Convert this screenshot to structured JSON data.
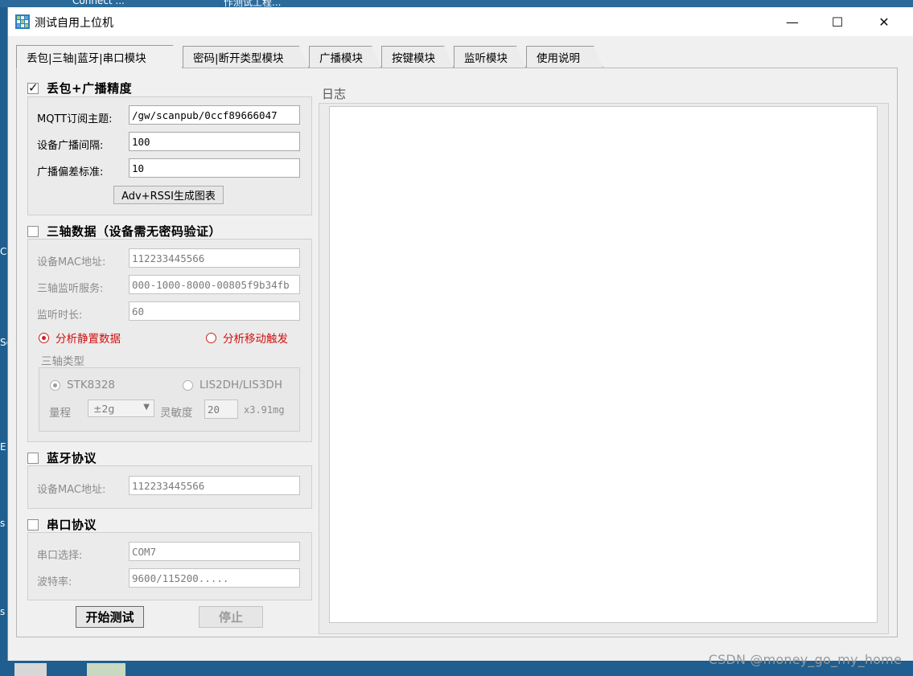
{
  "desktop": {
    "top_items": [
      "Connect ...",
      "作测试工程..."
    ],
    "left_letters": [
      "C",
      "Se",
      "E",
      "s",
      "s"
    ]
  },
  "window": {
    "title": "测试自用上位机",
    "minimize_glyph": "—",
    "maximize_glyph": "☐",
    "close_glyph": "✕"
  },
  "tabs": [
    {
      "label": "丢包|三轴|蓝牙|串口模块",
      "active": true
    },
    {
      "label": "密码|断开类型模块",
      "active": false
    },
    {
      "label": "广播模块",
      "active": false
    },
    {
      "label": "按键模块",
      "active": false
    },
    {
      "label": "监听模块",
      "active": false
    },
    {
      "label": "使用说明",
      "active": false
    }
  ],
  "loss": {
    "header": "丢包+广播精度",
    "checked": true,
    "mqtt_label": "MQTT订阅主题:",
    "mqtt_value": "/gw/scanpub/0ccf89666047",
    "interval_label": "设备广播间隔:",
    "interval_value": "100",
    "deviation_label": "广播偏差标准:",
    "deviation_value": "10",
    "chart_button": "Adv+RSSI生成图表"
  },
  "triaxial": {
    "header": "三轴数据（设备需无密码验证）",
    "checked": false,
    "mac_label": "设备MAC地址:",
    "mac_value": "112233445566",
    "service_label": "三轴监听服务:",
    "service_value": "000-1000-8000-00805f9b34fb",
    "duration_label": "监听时长:",
    "duration_value": "60",
    "radio_static": "分析静置数据",
    "radio_motion": "分析移动触发",
    "type_title": "三轴类型",
    "type_stk": "STK8328",
    "type_lis": "LIS2DH/LIS3DH",
    "range_label": "量程",
    "range_value": "±2g",
    "sensitivity_label": "灵敏度",
    "sensitivity_value": "20",
    "sensitivity_unit": "x3.91mg"
  },
  "bluetooth": {
    "header": "蓝牙协议",
    "checked": false,
    "mac_label": "设备MAC地址:",
    "mac_value": "112233445566"
  },
  "serial": {
    "header": "串口协议",
    "checked": false,
    "port_label": "串口选择:",
    "port_value": "COM7",
    "baud_label": "波特率:",
    "baud_value": "9600/115200....."
  },
  "actions": {
    "start": "开始测试",
    "stop": "停止"
  },
  "log": {
    "label": "日志"
  },
  "watermark": "CSDN @money_go_my_home"
}
